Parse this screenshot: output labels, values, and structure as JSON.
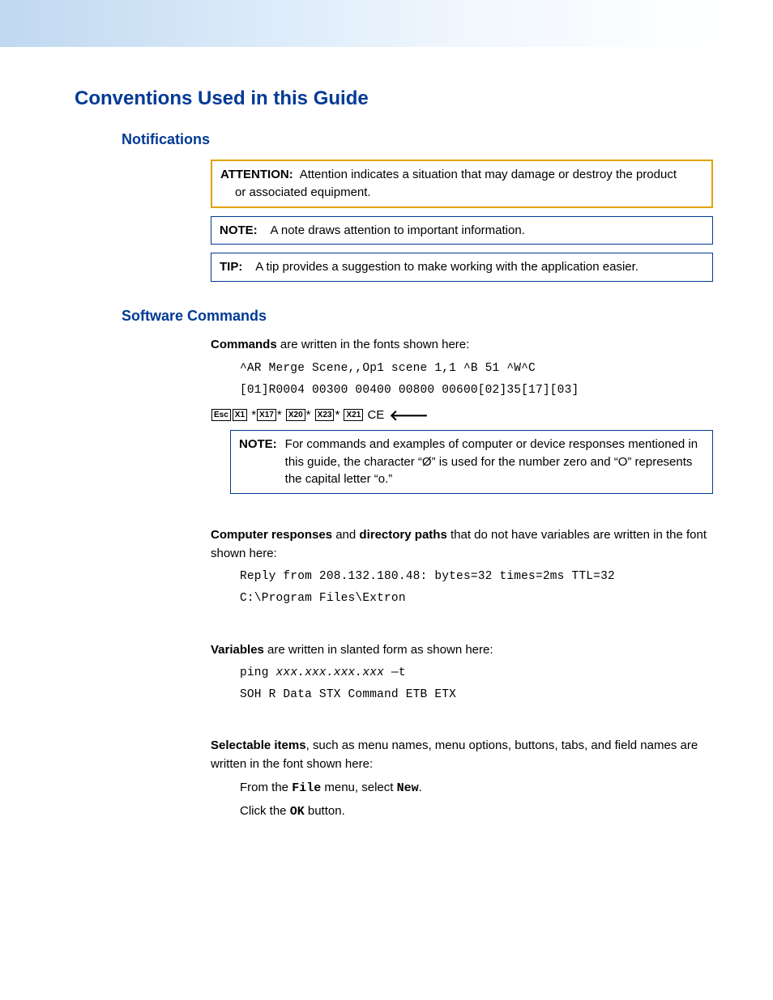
{
  "headings": {
    "title": "Conventions Used in this Guide",
    "notifications": "Notifications",
    "software": "Software Commands"
  },
  "boxes": {
    "attention_label": "ATTENTION:",
    "attention_text_1": "Attention indicates a situation that may damage or destroy the product",
    "attention_text_2": "or associated equipment.",
    "note_label": "NOTE:",
    "note_text": "A note draws attention to important information.",
    "tip_label": "TIP:",
    "tip_text": "A tip provides a suggestion to make working with the application easier.",
    "note2_label": "NOTE:",
    "note2_text": "For commands and examples of computer or device responses mentioned in this guide, the character “Ø” is used for the number zero and “O” represents the capital letter “o.”"
  },
  "commands": {
    "label": "Commands",
    "text": " are written in the fonts shown here:",
    "l1": "^AR Merge Scene,,Op1 scene 1,1 ^B 51 ^W^C",
    "l2": "[01]R0004 00300 00400 00800 00600[02]35[17][03]",
    "keys": {
      "esc": "Esc",
      "x1": "X1",
      "x17": "X17",
      "x20": "X20",
      "x23": "X23",
      "x21": "X21",
      "ce": "CE"
    }
  },
  "responses": {
    "label1": "Computer responses",
    "mid": " and ",
    "label2": "directory paths",
    "text": " that do not have variables are written in the font shown here:",
    "l1": "Reply from 208.132.180.48: bytes=32 times=2ms TTL=32",
    "l2": "C:\\Program Files\\Extron"
  },
  "variables": {
    "label": "Variables",
    "text": " are written in slanted form as shown here:",
    "l1a": "ping ",
    "l1b": "xxx.xxx.xxx.xxx",
    "l1c": " —t",
    "l2": "SOH R Data STX Command ETB ETX"
  },
  "selectable": {
    "label": "Selectable items",
    "text": ", such as menu names, menu options, buttons, tabs, and field names are written in the font shown here:",
    "s1a": "From the ",
    "s1b": "File",
    "s1c": " menu, select ",
    "s1d": "New",
    "s1e": ".",
    "s2a": "Click the ",
    "s2b": "OK",
    "s2c": " button."
  }
}
